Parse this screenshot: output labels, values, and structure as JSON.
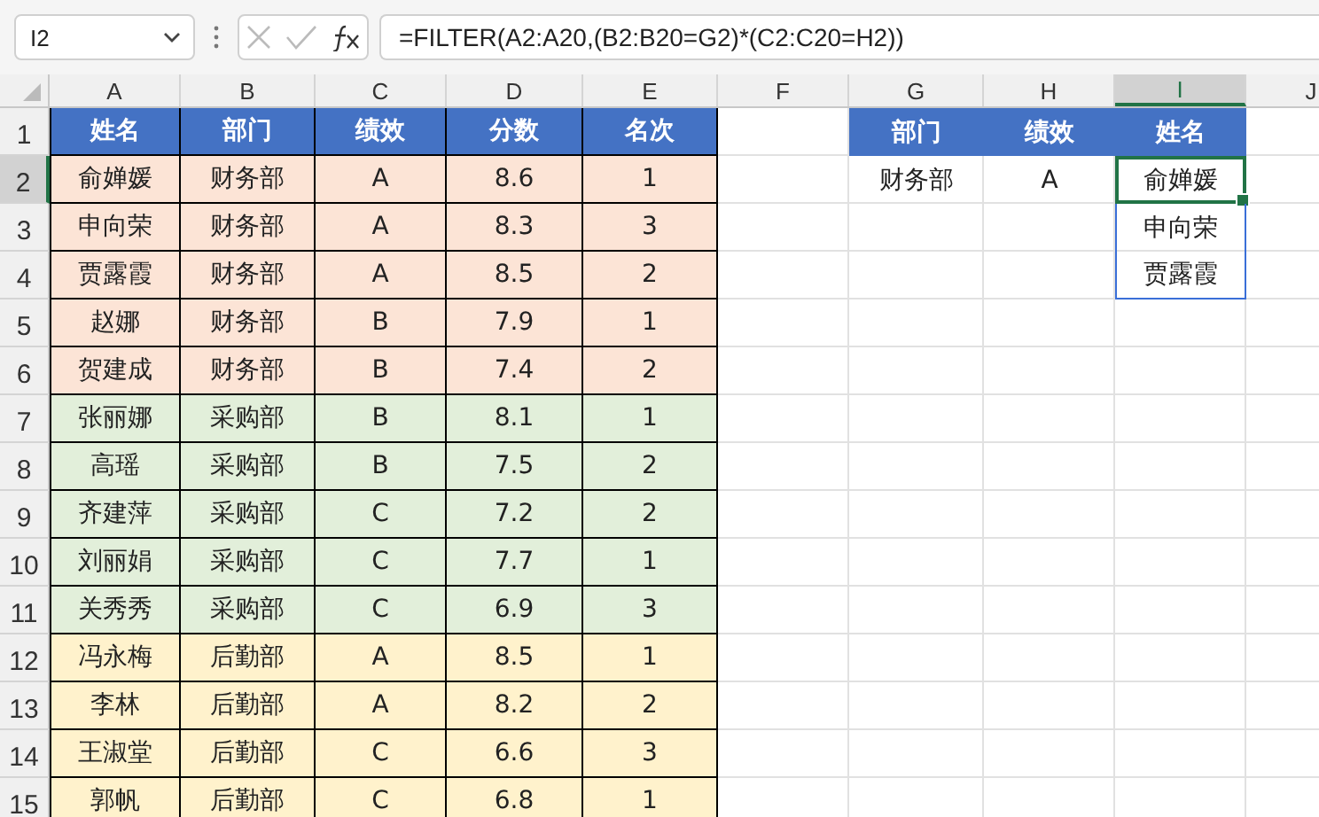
{
  "formula_bar": {
    "name_box": "I2",
    "formula": "=FILTER(A2:A20,(B2:B20=G2)*(C2:C20=H2))"
  },
  "column_headers": [
    {
      "label": "A",
      "selected": false
    },
    {
      "label": "B",
      "selected": false
    },
    {
      "label": "C",
      "selected": false
    },
    {
      "label": "D",
      "selected": false
    },
    {
      "label": "E",
      "selected": false
    },
    {
      "label": "F",
      "selected": false
    },
    {
      "label": "G",
      "selected": false
    },
    {
      "label": "H",
      "selected": false
    },
    {
      "label": "I",
      "selected": true
    },
    {
      "label": "J",
      "selected": false
    }
  ],
  "row_headers": [
    {
      "label": "1",
      "selected": false
    },
    {
      "label": "2",
      "selected": true
    },
    {
      "label": "3",
      "selected": false
    },
    {
      "label": "4",
      "selected": false
    },
    {
      "label": "5",
      "selected": false
    },
    {
      "label": "6",
      "selected": false
    },
    {
      "label": "7",
      "selected": false
    },
    {
      "label": "8",
      "selected": false
    },
    {
      "label": "9",
      "selected": false
    },
    {
      "label": "10",
      "selected": false
    },
    {
      "label": "11",
      "selected": false
    },
    {
      "label": "12",
      "selected": false
    },
    {
      "label": "13",
      "selected": false
    },
    {
      "label": "14",
      "selected": false
    },
    {
      "label": "15",
      "selected": false
    }
  ],
  "table": {
    "columns": [
      "姓名",
      "部门",
      "绩效",
      "分数",
      "名次"
    ],
    "rows": [
      {
        "color": "#fce4d6",
        "cells": [
          "俞婵媛",
          "财务部",
          "A",
          "8.6",
          "1"
        ]
      },
      {
        "color": "#fce4d6",
        "cells": [
          "申向荣",
          "财务部",
          "A",
          "8.3",
          "3"
        ]
      },
      {
        "color": "#fce4d6",
        "cells": [
          "贾露霞",
          "财务部",
          "A",
          "8.5",
          "2"
        ]
      },
      {
        "color": "#fce4d6",
        "cells": [
          "赵娜",
          "财务部",
          "B",
          "7.9",
          "1"
        ]
      },
      {
        "color": "#fce4d6",
        "cells": [
          "贺建成",
          "财务部",
          "B",
          "7.4",
          "2"
        ]
      },
      {
        "color": "#e2efda",
        "cells": [
          "张丽娜",
          "采购部",
          "B",
          "8.1",
          "1"
        ]
      },
      {
        "color": "#e2efda",
        "cells": [
          "高瑶",
          "采购部",
          "B",
          "7.5",
          "2"
        ]
      },
      {
        "color": "#e2efda",
        "cells": [
          "齐建萍",
          "采购部",
          "C",
          "7.2",
          "2"
        ]
      },
      {
        "color": "#e2efda",
        "cells": [
          "刘丽娟",
          "采购部",
          "C",
          "7.7",
          "1"
        ]
      },
      {
        "color": "#e2efda",
        "cells": [
          "关秀秀",
          "采购部",
          "C",
          "6.9",
          "3"
        ]
      },
      {
        "color": "#fff2cc",
        "cells": [
          "冯永梅",
          "后勤部",
          "A",
          "8.5",
          "1"
        ]
      },
      {
        "color": "#fff2cc",
        "cells": [
          "李林",
          "后勤部",
          "A",
          "8.2",
          "2"
        ]
      },
      {
        "color": "#fff2cc",
        "cells": [
          "王淑堂",
          "后勤部",
          "C",
          "6.6",
          "3"
        ]
      },
      {
        "color": "#fff2cc",
        "cells": [
          "郭帆",
          "后勤部",
          "C",
          "6.8",
          "1"
        ]
      }
    ]
  },
  "criteria": {
    "columns": [
      "部门",
      "绩效",
      "姓名"
    ],
    "values": [
      "财务部",
      "A"
    ],
    "results": [
      {
        "value": "俞婵媛",
        "selected": true
      },
      {
        "value": "申向荣",
        "selected": false
      },
      {
        "value": "贾露霞",
        "selected": false
      }
    ]
  }
}
